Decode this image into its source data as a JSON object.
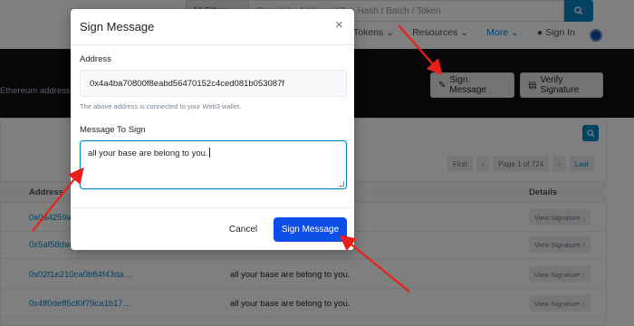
{
  "header": {
    "filter_label": "All Filters",
    "search_placeholder": "Search by Address / Txn Hash / Batch / Token",
    "nav": [
      "Tokens",
      "Resources",
      "More",
      "Sign In"
    ]
  },
  "banner": {
    "text": "Ethereum address.",
    "sign_message_label": "Sign Message",
    "verify_signature_label": "Verify Signature"
  },
  "pager": {
    "first": "First",
    "prev": "‹",
    "page": "Page 1 of 724",
    "next": "›",
    "last": "Last"
  },
  "table": {
    "columns": {
      "address": "Address",
      "details": "Details"
    },
    "view_label": "View Signature",
    "rows": [
      {
        "address": "0x0a4259a",
        "message": ""
      },
      {
        "address": "0x5af58da6",
        "message": ""
      },
      {
        "address": "0x02f1e210ca0b84f43da…",
        "message": "all your base are belong to you."
      },
      {
        "address": "0x4ff0deff5cf0f79ca1b17…",
        "message": "all your base are belong to you."
      }
    ]
  },
  "modal": {
    "title": "Sign Message",
    "close": "×",
    "address_label": "Address",
    "address_value": "0x4a4ba70800f8eabd56470152c4ced081b053087f",
    "address_help": "The above address is connected to your Web3 wallet.",
    "message_label": "Message To Sign",
    "message_value": "all your base are belong to you.",
    "cancel_label": "Cancel",
    "sign_label": "Sign Message"
  },
  "colors": {
    "primary": "#0d4fe6",
    "link": "#0784c3",
    "arrow": "#e8201a"
  },
  "icons": [
    "search-icon",
    "chevron-down-icon",
    "user-icon",
    "sign-icon",
    "document-icon",
    "chevron-right-icon",
    "close-icon"
  ]
}
